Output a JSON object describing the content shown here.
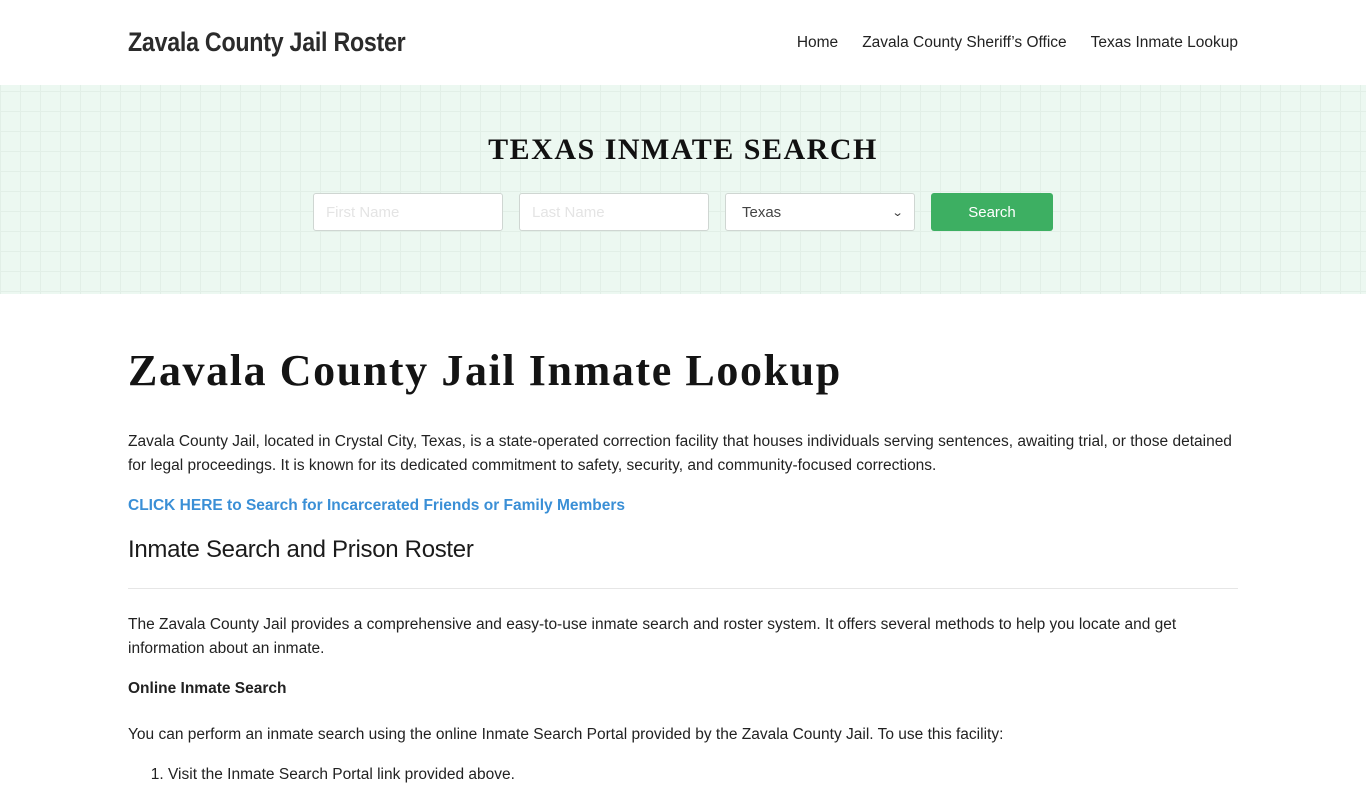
{
  "header": {
    "site_title": "Zavala County Jail Roster",
    "nav": [
      {
        "label": "Home"
      },
      {
        "label": "Zavala County Sheriff’s Office"
      },
      {
        "label": "Texas Inmate Lookup"
      }
    ]
  },
  "hero": {
    "title": "TEXAS INMATE SEARCH",
    "first_name_placeholder": "First Name",
    "first_name_value": "",
    "last_name_placeholder": "Last Name",
    "last_name_value": "",
    "state_selected": "Texas",
    "search_label": "Search"
  },
  "main": {
    "title": "Zavala County Jail Inmate Lookup",
    "intro": "Zavala County Jail, located in Crystal City, Texas, is a state-operated correction facility that houses individuals serving sentences, awaiting trial, or those detained for legal proceedings. It is known for its dedicated commitment to safety, security, and community-focused corrections.",
    "cta_link": "CLICK HERE to Search for Incarcerated Friends or Family Members",
    "section_heading": "Inmate Search and Prison Roster",
    "section_paragraph": "The Zavala County Jail provides a comprehensive and easy-to-use inmate search and roster system. It offers several methods to help you locate and get information about an inmate.",
    "online_search_heading": "Online Inmate Search",
    "online_search_paragraph": "You can perform an inmate search using the online Inmate Search Portal provided by the Zavala County Jail. To use this facility:",
    "steps": [
      "Visit the Inmate Search Portal link provided above."
    ]
  },
  "colors": {
    "accent_green": "#3daf62",
    "link_blue": "#3a8fd6",
    "hero_bg": "#ecf8f1"
  }
}
